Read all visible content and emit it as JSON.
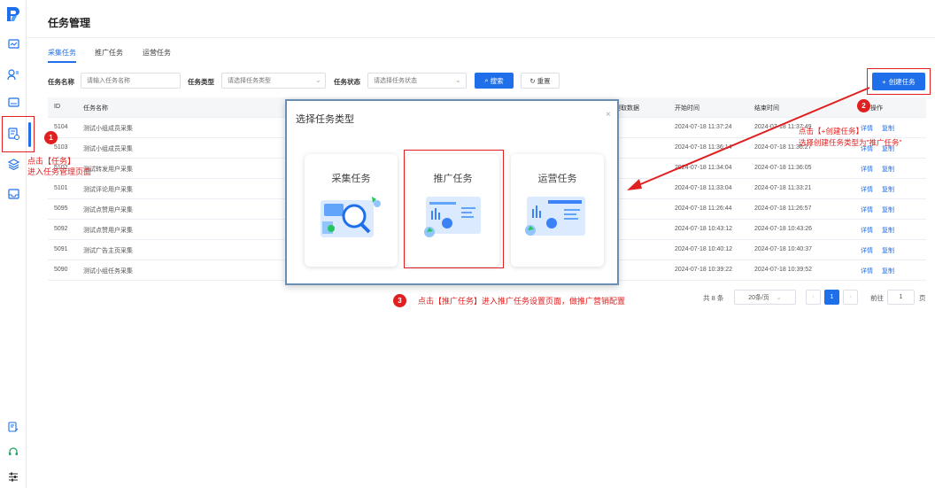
{
  "page": {
    "title": "任务管理"
  },
  "tabs": [
    {
      "label": "采集任务",
      "active": true
    },
    {
      "label": "推广任务"
    },
    {
      "label": "运营任务"
    }
  ],
  "filters": {
    "name_label": "任务名称",
    "name_placeholder": "请输入任务名称",
    "type_label": "任务类型",
    "type_placeholder": "请选择任务类型",
    "status_label": "任务状态",
    "status_placeholder": "请选择任务状态",
    "search_label": "搜索",
    "reset_label": "重置"
  },
  "toolbar": {
    "create_label": "创建任务"
  },
  "table": {
    "headers": {
      "id": "ID",
      "name": "任务名称",
      "stat": "爬取数据",
      "start": "开始时间",
      "end": "结束时间",
      "op": "操作"
    },
    "rows": [
      {
        "id": "5104",
        "name": "测试小组成员采集",
        "start": "2024-07-18 11:37:24",
        "end": "2024-07-18 11:37:49",
        "op1": "详情",
        "op2": "复制"
      },
      {
        "id": "5103",
        "name": "测试小组成员采集",
        "start": "2024-07-18 11:36:14",
        "end": "2024-07-18 11:36:27",
        "op1": "详情",
        "op2": "复制"
      },
      {
        "id": "5102",
        "name": "测试转发用户采集",
        "start": "2024-07-18 11:34:04",
        "end": "2024-07-18 11:36:05",
        "op1": "详情",
        "op2": "复制"
      },
      {
        "id": "5101",
        "name": "测试评论用户采集",
        "start": "2024-07-18 11:33:04",
        "end": "2024-07-18 11:33:21",
        "op1": "详情",
        "op2": "复制"
      },
      {
        "id": "5095",
        "name": "测试点赞用户采集",
        "start": "2024-07-18 11:26:44",
        "end": "2024-07-18 11:26:57",
        "op1": "详情",
        "op2": "复制"
      },
      {
        "id": "5092",
        "name": "测试点赞用户采集",
        "start": "2024-07-18 10:43:12",
        "end": "2024-07-18 10:43:26",
        "op1": "详情",
        "op2": "复制"
      },
      {
        "id": "5091",
        "name": "测试广告主页采集",
        "start": "2024-07-18 10:40:12",
        "end": "2024-07-18 10:40:37",
        "op1": "详情",
        "op2": "复制"
      },
      {
        "id": "5090",
        "name": "测试小组任务采集",
        "start": "2024-07-18 10:39:22",
        "end": "2024-07-18 10:39:52",
        "op1": "详情",
        "op2": "复制"
      }
    ]
  },
  "pagination": {
    "total": "共 8 条",
    "per_page": "20条/页",
    "current": "1",
    "goto_label": "前往",
    "goto_value": "1",
    "page_suffix": "页"
  },
  "modal": {
    "title": "选择任务类型",
    "close": "×",
    "cards": [
      {
        "label": "采集任务"
      },
      {
        "label": "推广任务"
      },
      {
        "label": "运营任务"
      }
    ]
  },
  "annotations": {
    "step1_num": "1",
    "step1_line1": "点击【任务】",
    "step1_line2": "进入任务管理页面",
    "step2_num": "2",
    "step2_line1": "点击【+创建任务】",
    "step2_line2": "选择创建任务类型为\"推广任务\"",
    "step3_num": "3",
    "step3_text": "点击【推广任务】进入推广任务设置页面，做推广营销配置"
  },
  "colors": {
    "primary": "#1f6feb",
    "annotation": "#e02020"
  }
}
